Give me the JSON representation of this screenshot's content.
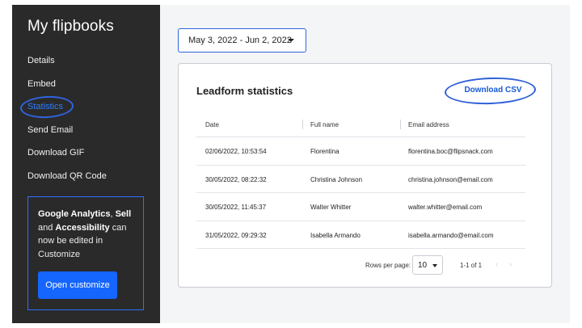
{
  "sidebar": {
    "title": "My flipbooks",
    "items": [
      {
        "label": "Details"
      },
      {
        "label": "Embed"
      },
      {
        "label": "Statistics"
      },
      {
        "label": "Send Email"
      },
      {
        "label": "Download GIF"
      },
      {
        "label": "Download QR Code"
      }
    ],
    "active_item": "Statistics",
    "promo": {
      "bold1": "Google Analytics",
      "text1": ", ",
      "bold2": "Sell",
      "text2": " and ",
      "bold3": "Accessibility",
      "text3": " can now be edited in Customize",
      "button_label": "Open customize"
    }
  },
  "date_range": {
    "value": "May 3, 2022 - Jun 2, 2022"
  },
  "card": {
    "title": "Leadform statistics",
    "download_label": "Download CSV",
    "columns": [
      "Date",
      "Full name",
      "Email address"
    ],
    "rows": [
      {
        "date": "02/06/2022, 10:53:54",
        "name": "Florentina",
        "email": "florentina.boc@flipsnack.com"
      },
      {
        "date": "30/05/2022, 08:22:32",
        "name": "Christina Johnson",
        "email": "christina.johnson@email.com"
      },
      {
        "date": "30/05/2022, 11:45:37",
        "name": "Walter Whitter",
        "email": "walter.whitter@email.com"
      },
      {
        "date": "31/05/2022, 09:29:32",
        "name": "Isabella Armando",
        "email": "isabella.armando@email.com"
      }
    ],
    "pagination": {
      "rows_per_page_label": "Rows per page:",
      "rows_per_page": "10",
      "range": "1-1 of 1",
      "prev_icon": "chevron-left-icon",
      "next_icon": "chevron-right-icon"
    }
  },
  "colors": {
    "sidebar_bg": "#2a2a2a",
    "accent": "#1565ff",
    "annotation": "#2f64e0"
  }
}
